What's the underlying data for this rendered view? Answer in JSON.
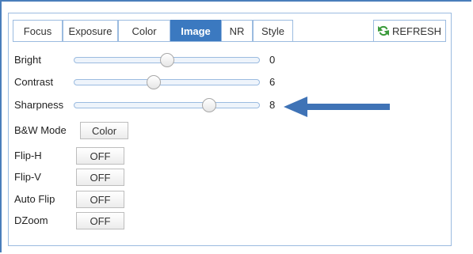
{
  "tabs": [
    {
      "label": "Focus",
      "active": false
    },
    {
      "label": "Exposure",
      "active": false
    },
    {
      "label": "Color",
      "active": false
    },
    {
      "label": "Image",
      "active": true
    },
    {
      "label": "NR",
      "active": false
    },
    {
      "label": "Style",
      "active": false
    }
  ],
  "refresh": {
    "label": "REFRESH",
    "icon": "refresh-icon",
    "icon_color": "#3a9a3a"
  },
  "sliders": [
    {
      "label": "Bright",
      "value": "0",
      "position": 0.5
    },
    {
      "label": "Contrast",
      "value": "6",
      "position": 0.43
    },
    {
      "label": "Sharpness",
      "value": "8",
      "position": 0.73
    }
  ],
  "toggles": [
    {
      "label": "B&W Mode",
      "value": "Color"
    },
    {
      "label": "Flip-H",
      "value": "OFF"
    },
    {
      "label": "Flip-V",
      "value": "OFF"
    },
    {
      "label": "Auto Flip",
      "value": "OFF"
    },
    {
      "label": "DZoom",
      "value": "OFF"
    }
  ],
  "colors": {
    "accent": "#3b79c0",
    "border": "#9bbbe0",
    "annotation_arrow": "#3f73b6"
  }
}
